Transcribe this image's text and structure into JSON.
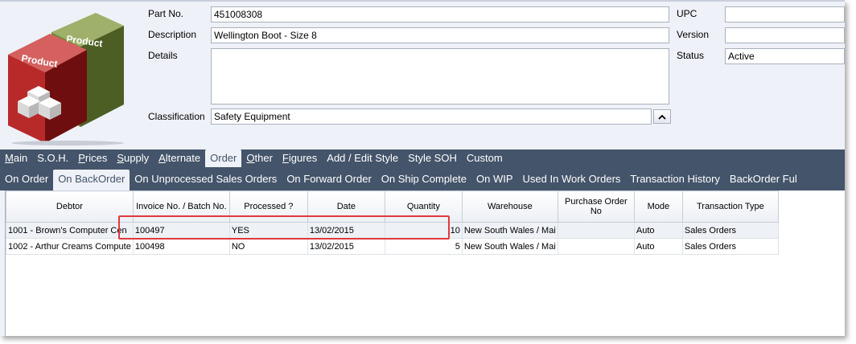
{
  "product_image": {
    "front_label": "Product",
    "back_label": "Product"
  },
  "form": {
    "part_no_label": "Part No.",
    "part_no_value": "451008308",
    "description_label": "Description",
    "description_value": "Wellington Boot - Size 8",
    "details_label": "Details",
    "details_value": "",
    "classification_label": "Classification",
    "classification_value": "Safety Equipment",
    "upc_label": "UPC",
    "upc_value": "",
    "version_label": "Version",
    "version_value": "",
    "status_label": "Status",
    "status_value": "Active"
  },
  "main_tabs": [
    {
      "label": "Main",
      "accel": "M",
      "rest": "ain"
    },
    {
      "label": "S.O.H.",
      "accel": "",
      "rest": "S.O.H."
    },
    {
      "label": "Prices",
      "accel": "P",
      "rest": "rices"
    },
    {
      "label": "Supply",
      "accel": "S",
      "rest": "upply"
    },
    {
      "label": "Alternate",
      "accel": "A",
      "rest": "lternate"
    },
    {
      "label": "Order",
      "accel": "",
      "rest": "Order"
    },
    {
      "label": "Other",
      "accel": "O",
      "rest": "ther"
    },
    {
      "label": "Figures",
      "accel": "F",
      "rest": "igures"
    },
    {
      "label": "Add / Edit Style",
      "accel": "",
      "rest": "Add / Edit Style"
    },
    {
      "label": "Style SOH",
      "accel": "",
      "rest": "Style SOH"
    },
    {
      "label": "Custom",
      "accel": "",
      "rest": "Custom"
    }
  ],
  "main_tabs_active": "Order",
  "sub_tabs": [
    "On Order",
    "On BackOrder",
    "On Unprocessed Sales Orders",
    "On Forward Order",
    "On Ship Complete",
    "On WIP",
    "Used In Work Orders",
    "Transaction History",
    "BackOrder Ful"
  ],
  "sub_tabs_active": "On BackOrder",
  "grid": {
    "columns": [
      "Debtor",
      "Invoice No. / Batch No.",
      "Processed ?",
      "Date",
      "Quantity",
      "Warehouse",
      "Purchase Order No",
      "Mode",
      "Transaction Type"
    ],
    "rows": [
      [
        "1001 - Brown's Computer Cen",
        "100497",
        "YES",
        "13/02/2015",
        "10",
        "New South Wales / Mai",
        "",
        "Auto",
        "Sales Orders"
      ],
      [
        "1002 - Arthur Creams Compute",
        "100498",
        "NO",
        "13/02/2015",
        "5",
        "New South Wales / Mai",
        "",
        "Auto",
        "Sales Orders"
      ]
    ]
  },
  "colors": {
    "tab_bar": "#44546a",
    "highlight": "#e0393e",
    "panel": "#eef1f7"
  }
}
